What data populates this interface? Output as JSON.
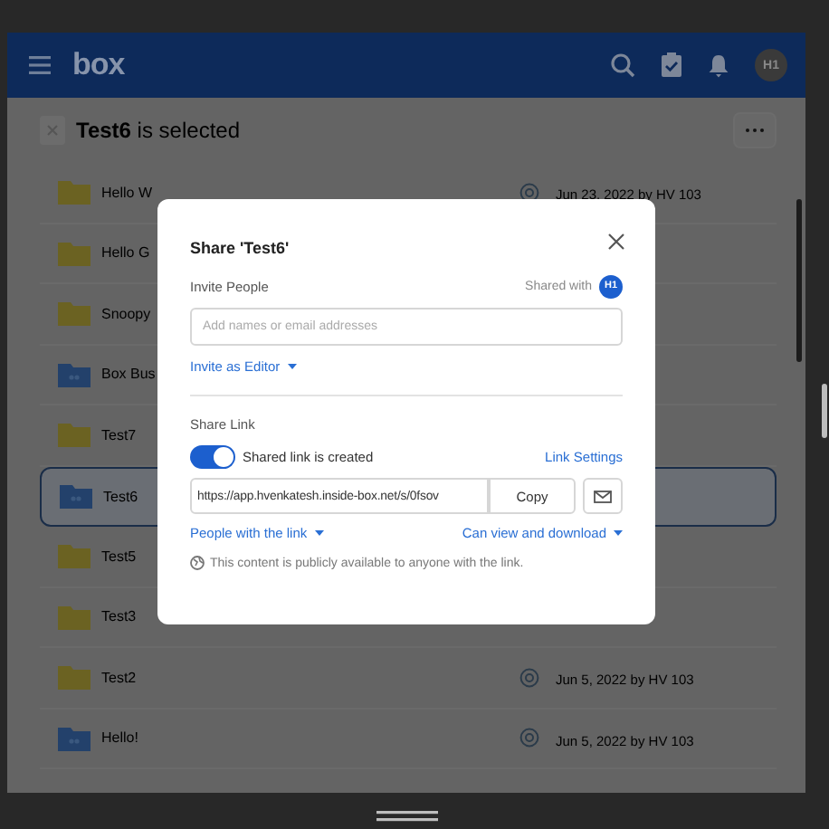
{
  "header": {
    "logo": "box",
    "avatar": "H1"
  },
  "selection": {
    "name": "Test6",
    "suffix": "is selected"
  },
  "rows": [
    {
      "name": "Hello W",
      "kind": "folder",
      "selected": false,
      "collab": true,
      "modified": "Jun 23, 2022 by HV 103"
    },
    {
      "name": "Hello G",
      "kind": "folder",
      "selected": false,
      "collab": false
    },
    {
      "name": "Snoopy",
      "kind": "folder",
      "selected": false,
      "collab": false
    },
    {
      "name": "Box Bus",
      "kind": "shared",
      "selected": false,
      "collab": false
    },
    {
      "name": "Test7",
      "kind": "folder",
      "selected": false,
      "collab": false
    },
    {
      "name": "Test6",
      "kind": "shared",
      "selected": true,
      "collab": false
    },
    {
      "name": "Test5",
      "kind": "folder",
      "selected": false,
      "collab": false
    },
    {
      "name": "Test3",
      "kind": "folder",
      "selected": false,
      "collab": false
    },
    {
      "name": "Test2",
      "kind": "folder",
      "selected": false,
      "collab": true,
      "modified": "Jun 5, 2022 by HV 103"
    },
    {
      "name": "Hello!",
      "kind": "shared",
      "selected": false,
      "collab": true,
      "modified": "Jun 5, 2022 by HV 103"
    }
  ],
  "modal": {
    "title": "Share 'Test6'",
    "invite_label": "Invite People",
    "shared_with": "Shared with",
    "avatar": "H1",
    "placeholder": "Add names or email addresses",
    "invite_as": "Invite as Editor",
    "share_link_label": "Share Link",
    "toggle": {
      "on": true,
      "label": "Shared link is created"
    },
    "link_settings": "Link Settings",
    "url": "https://app.hvenkatesh.inside-box.net/s/0fsov",
    "copy": "Copy",
    "access": "People with the link",
    "permission": "Can view and download",
    "notice": "This content is publicly available to anyone with the link."
  }
}
